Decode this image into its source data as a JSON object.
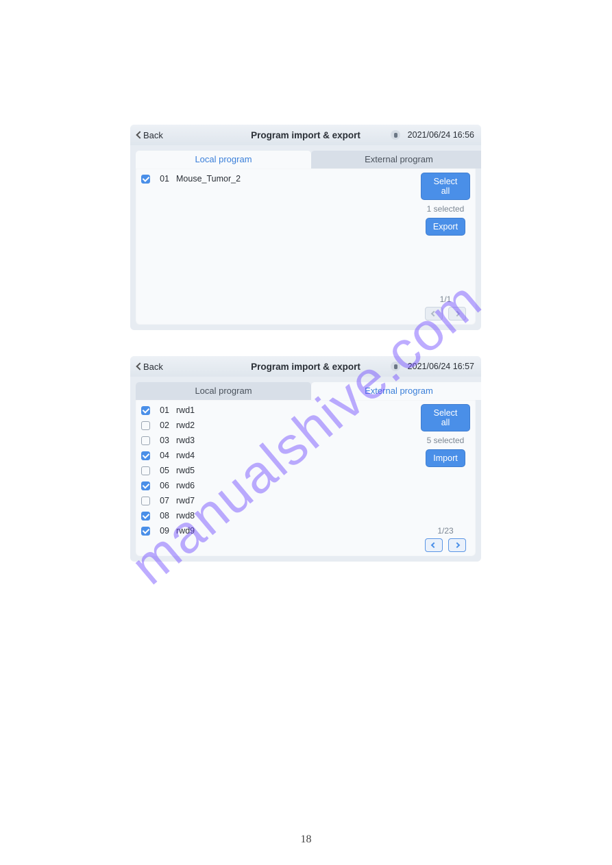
{
  "watermark": "manualshive.com",
  "page_number": "18",
  "panel1": {
    "back": "Back",
    "title": "Program import & export",
    "datetime": "2021/06/24 16:56",
    "tabs": {
      "local": "Local program",
      "external": "External program"
    },
    "items": [
      {
        "num": "01",
        "name": "Mouse_Tumor_2",
        "checked": true
      }
    ],
    "select_all": "Select all",
    "selected": "1 selected",
    "action": "Export",
    "page": "1/1",
    "prev_enabled": false,
    "next_enabled": false
  },
  "panel2": {
    "back": "Back",
    "title": "Program import & export",
    "datetime": "2021/06/24 16:57",
    "tabs": {
      "local": "Local program",
      "external": "External program"
    },
    "items": [
      {
        "num": "01",
        "name": "rwd1",
        "checked": true
      },
      {
        "num": "02",
        "name": "rwd2",
        "checked": false
      },
      {
        "num": "03",
        "name": "rwd3",
        "checked": false
      },
      {
        "num": "04",
        "name": "rwd4",
        "checked": true
      },
      {
        "num": "05",
        "name": "rwd5",
        "checked": false
      },
      {
        "num": "06",
        "name": "rwd6",
        "checked": true
      },
      {
        "num": "07",
        "name": "rwd7",
        "checked": false
      },
      {
        "num": "08",
        "name": "rwd8",
        "checked": true
      },
      {
        "num": "09",
        "name": "rwd9",
        "checked": true
      }
    ],
    "select_all": "Select all",
    "selected": "5 selected",
    "action": "Import",
    "page": "1/23",
    "prev_enabled": true,
    "next_enabled": true
  }
}
